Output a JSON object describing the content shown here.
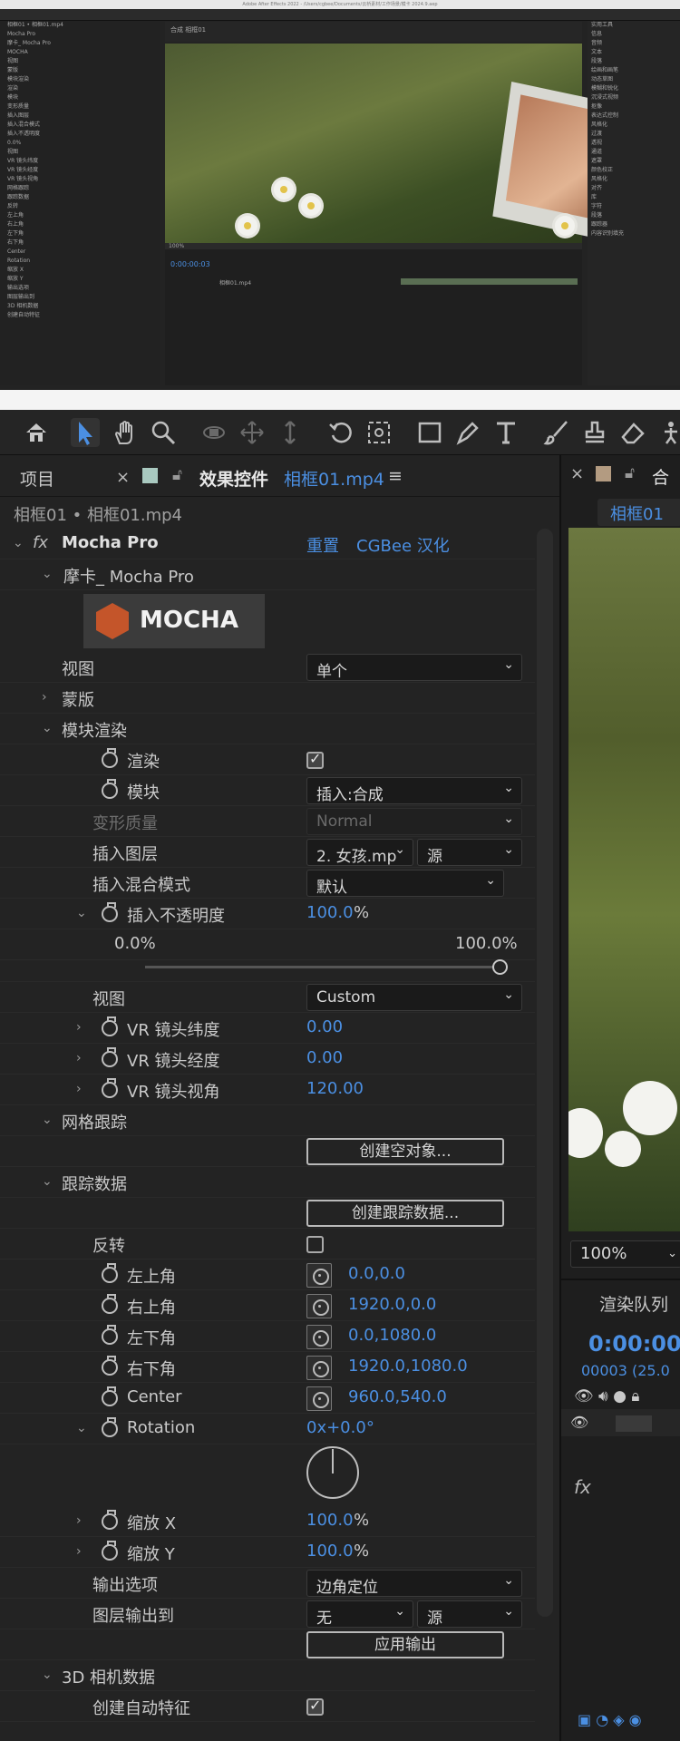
{
  "thumbnail": {
    "title": "Adobe After Effects 2022 - /Users/cgbee/Documents/云桥素材/工作场景/模卡 2024.9.aep",
    "left_rows": [
      "相框01 • 相框01.mp4",
      "Mocha Pro",
      "摩卡_ Mocha Pro",
      "MOCHA",
      "视图",
      "蒙版",
      "模块渲染",
      "渲染",
      "模块",
      "变形质量",
      "插入图层",
      "插入混合模式",
      "插入不透明度",
      "0.0%",
      "视图",
      "VR 镜头纬度",
      "VR 镜头经度",
      "VR 镜头视角",
      "网格跟踪",
      "跟踪数据",
      "反转",
      "左上角",
      "右上角",
      "左下角",
      "右下角",
      "Center",
      "Rotation",
      "缩放 X",
      "缩放 Y",
      "输出选项",
      "图层输出到",
      "3D 相机数据",
      "创建自动特征"
    ],
    "right_rows": [
      "实用工具",
      "信息",
      "音频",
      "文本",
      "段落",
      "绘画和画笔",
      "动态草图",
      "模糊和锐化",
      "沉浸式视频",
      "抠像",
      "表达式控制",
      "风格化",
      "过渡",
      "透视",
      "通道",
      "遮罩",
      "颜色校正",
      "风格化",
      "对齐",
      "库",
      "字符",
      "段落",
      "跟踪器",
      "内容识别填充"
    ],
    "timeline_time": "0:00:00:03",
    "timeline_layer": "相框01.mp4",
    "zoom": "100%",
    "comp_tab": "合成 相框01"
  },
  "toolbar": {
    "tools": [
      "home-icon",
      "selection-tool-icon",
      "hand-tool-icon",
      "zoom-tool-icon",
      "orbit-camera-icon",
      "pan-camera-icon",
      "dolly-camera-icon",
      "rotation-tool-icon",
      "anchor-tool-icon",
      "rectangle-tool-icon",
      "pen-tool-icon",
      "text-tool-icon",
      "brush-tool-icon",
      "clone-stamp-icon",
      "eraser-tool-icon",
      "puppet-tool-icon"
    ]
  },
  "panel": {
    "tab_project": "项目",
    "tab_effect": "效果控件",
    "tab_layer": "相框01.mp4",
    "menu": "≡",
    "layer_header": "相框01 • 相框01.mp4",
    "effect_name": "Mocha Pro",
    "reset": "重置",
    "cgbee": "CGBee 汉化",
    "mocha_group": "摩卡_ Mocha Pro",
    "mocha_logo": "MOCHA",
    "view_label": "视图",
    "view_value": "单个",
    "mask_label": "蒙版",
    "render_label": "模块渲染",
    "render_checkbox": "渲染",
    "module_label": "模块",
    "module_value": "插入:合成",
    "warp_label": "变形质量",
    "warp_value": "Normal",
    "insert_layer_label": "插入图层",
    "insert_layer_value": "2. 女孩.mp",
    "insert_layer_src": "源",
    "blend_label": "插入混合模式",
    "blend_value": "默认",
    "opacity_label": "插入不透明度",
    "opacity_value": "100.0",
    "opacity_unit": "%",
    "slider_min": "0.0%",
    "slider_max": "100.0%",
    "slider_level": 1.0,
    "view2_label": "视图",
    "view2_value": "Custom",
    "vr_lat_label": "VR 镜头纬度",
    "vr_lat_value": "0.00",
    "vr_lon_label": "VR 镜头经度",
    "vr_lon_value": "0.00",
    "vr_fov_label": "VR 镜头视角",
    "vr_fov_value": "120.00",
    "mesh_label": "网格跟踪",
    "create_null_btn": "创建空对象...",
    "track_label": "跟踪数据",
    "create_track_btn": "创建跟踪数据...",
    "invert_label": "反转",
    "tl_label": "左上角",
    "tl_value": "0.0,0.0",
    "tr_label": "右上角",
    "tr_value": "1920.0,0.0",
    "bl_label": "左下角",
    "bl_value": "0.0,1080.0",
    "br_label": "右下角",
    "br_value": "1920.0,1080.0",
    "center_label": "Center",
    "center_value": "960.0,540.0",
    "rotation_label": "Rotation",
    "rotation_value": "0x+0.0°",
    "scale_x_label": "缩放 X",
    "scale_x_value": "100.0",
    "scale_y_label": "缩放 Y",
    "scale_y_value": "100.0",
    "scale_unit": "%",
    "output_opt_label": "输出选项",
    "output_opt_value": "边角定位",
    "layer_out_label": "图层输出到",
    "layer_out_value": "无",
    "layer_out_src": "源",
    "apply_btn": "应用输出",
    "cam3d_label": "3D 相机数据",
    "auto_feat_label": "创建自动特征"
  },
  "comp": {
    "tab": "合",
    "name": "相框01",
    "zoom": "100%",
    "render_queue": "渲染队列",
    "time": "0:00:00",
    "frames": "00003 (25.0",
    "fx": "fx"
  }
}
